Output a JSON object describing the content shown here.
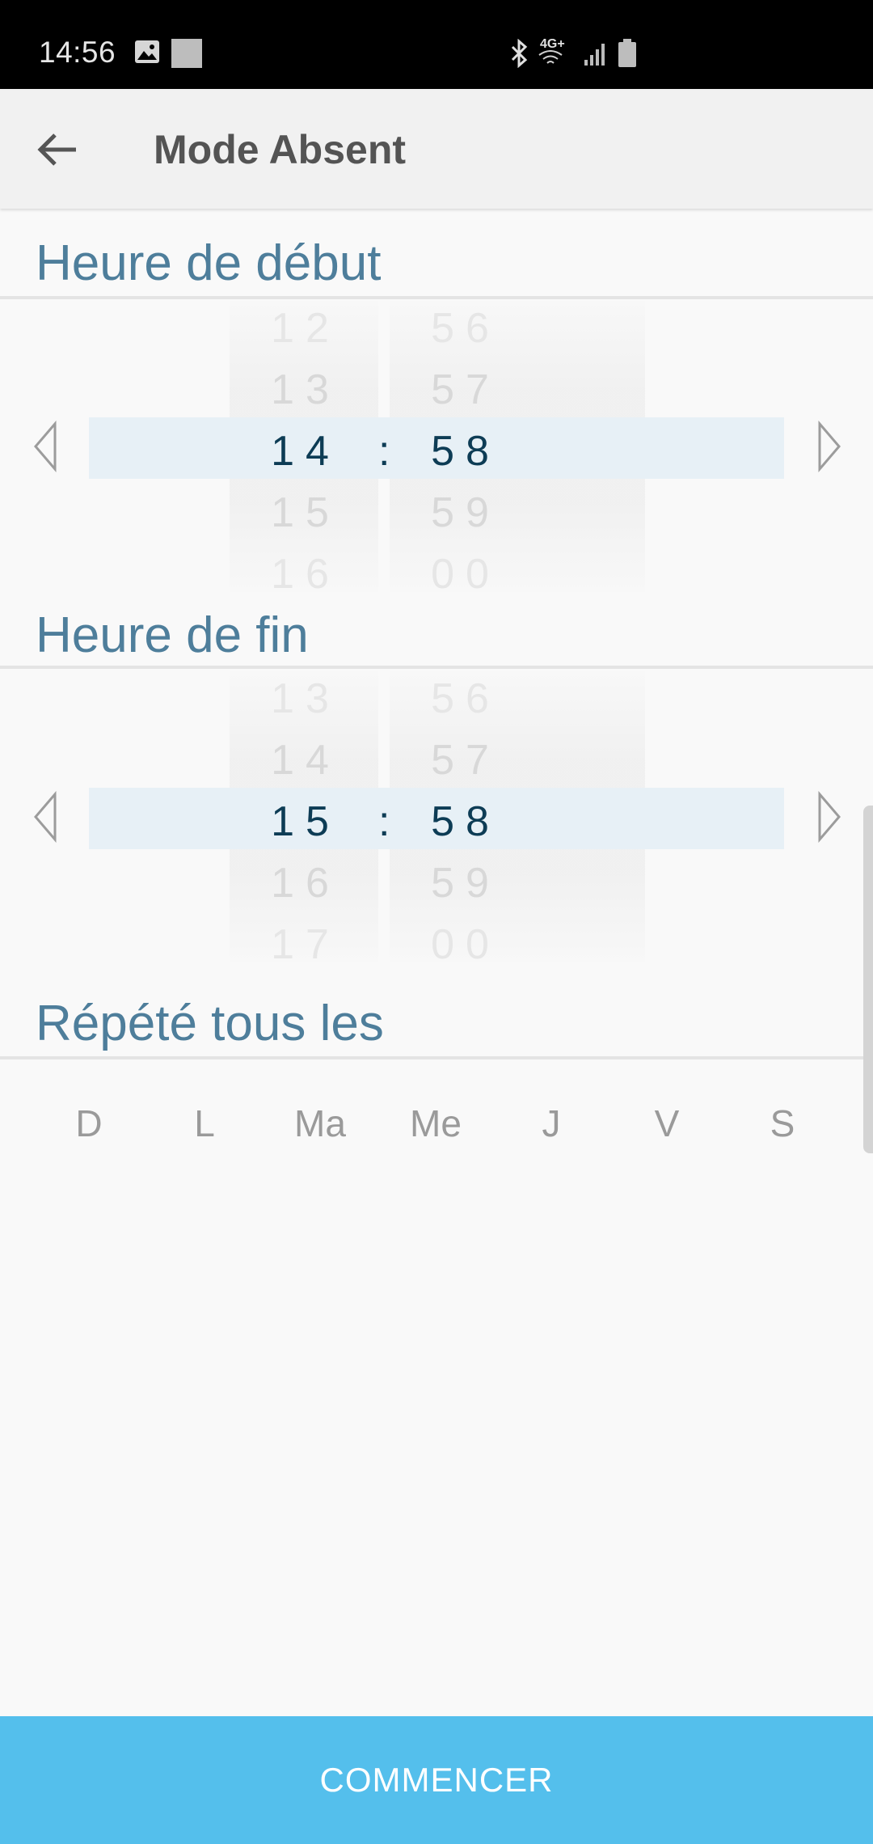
{
  "status_bar": {
    "time": "14:56",
    "network": "4G+",
    "icons": [
      "image-icon",
      "square-icon",
      "bluetooth-icon",
      "wifi-icon",
      "signal-icon",
      "battery-icon"
    ]
  },
  "app_bar": {
    "title": "Mode Absent",
    "back_icon": "arrow-left-icon"
  },
  "start_time": {
    "header": "Heure de début",
    "hours": [
      "12",
      "13",
      "14",
      "15",
      "16"
    ],
    "minutes": [
      "56",
      "57",
      "58",
      "59",
      "00"
    ],
    "separator": ":",
    "selected_hour": "14",
    "selected_minute": "58"
  },
  "end_time": {
    "header": "Heure de fin",
    "hours": [
      "13",
      "14",
      "15",
      "16",
      "17"
    ],
    "minutes": [
      "56",
      "57",
      "58",
      "59",
      "00"
    ],
    "separator": ":",
    "selected_hour": "15",
    "selected_minute": "58"
  },
  "repeat": {
    "header": "Répété tous les",
    "days": [
      "D",
      "L",
      "Ma",
      "Me",
      "J",
      "V",
      "S"
    ]
  },
  "actions": {
    "start_label": "COMMENCER"
  },
  "colors": {
    "accent": "#54bfec",
    "header_text": "#4e7e9b",
    "selected_text": "#0d3c55",
    "highlight": "#e7f0f6"
  }
}
